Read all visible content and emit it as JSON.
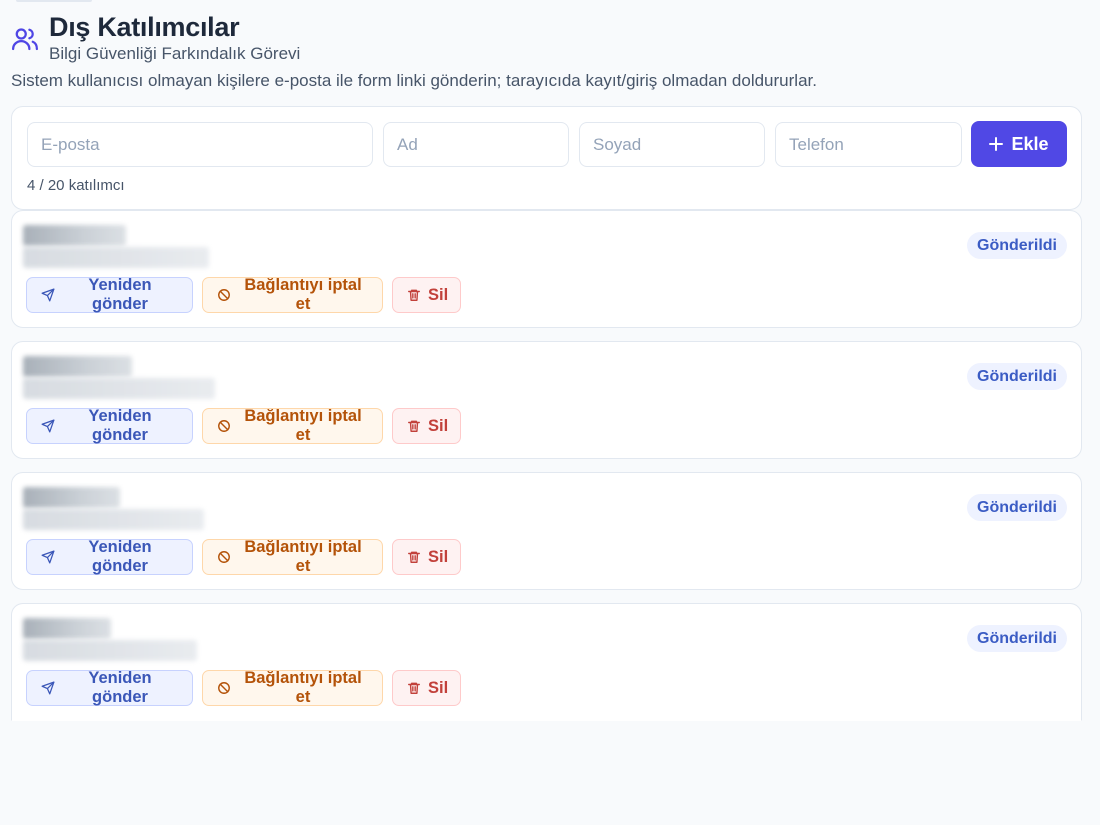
{
  "header": {
    "title": "Dış Katılımcılar",
    "subtitle": "Bilgi Güvenliği Farkındalık Görevi",
    "description": "Sistem kullanıcısı olmayan kişilere e-posta ile form linki gönderin; tarayıcıda kayıt/giriş olmadan doldururlar.",
    "icon": "users-icon"
  },
  "form": {
    "email_placeholder": "E-posta",
    "first_name_placeholder": "Ad",
    "last_name_placeholder": "Soyad",
    "phone_placeholder": "Telefon",
    "add_label": "Ekle",
    "count_text": "4 / 20 katılımcı"
  },
  "participants": [
    {
      "status": "Gönderildi",
      "resend_label": "Yeniden gönder",
      "revoke_label": "Bağlantıyı iptal et",
      "delete_label": "Sil"
    },
    {
      "status": "Gönderildi",
      "resend_label": "Yeniden gönder",
      "revoke_label": "Bağlantıyı iptal et",
      "delete_label": "Sil"
    },
    {
      "status": "Gönderildi",
      "resend_label": "Yeniden gönder",
      "revoke_label": "Bağlantıyı iptal et",
      "delete_label": "Sil"
    },
    {
      "status": "Gönderildi",
      "resend_label": "Yeniden gönder",
      "revoke_label": "Bağlantıyı iptal et",
      "delete_label": "Sil"
    }
  ],
  "colors": {
    "primary": "#5048e5",
    "badge_text": "#3b5cc4",
    "revoke_text": "#b45309",
    "delete_text": "#c2413b"
  }
}
